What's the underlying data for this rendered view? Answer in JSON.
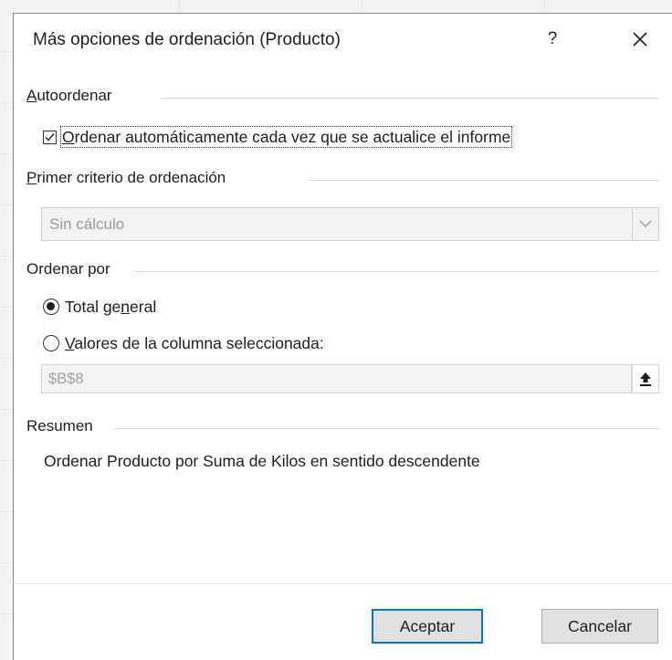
{
  "dialog": {
    "title": "Más opciones de ordenación (Producto)",
    "help_label": "?",
    "close_label": "×"
  },
  "autosort": {
    "section_title_first": "A",
    "section_title_rest": "utoordenar",
    "checkbox_checked": true,
    "checkbox_label_first": "O",
    "checkbox_label_rest": "rdenar automáticamente cada vez que se actualice el informe"
  },
  "first_key": {
    "section_title_first": "P",
    "section_title_rest": "rimer criterio de ordenación",
    "selected_value": "Sin cálculo"
  },
  "sort_by": {
    "section_title": "Ordenar por",
    "options": [
      {
        "pre": "Total ge",
        "accel": "n",
        "post": "eral",
        "selected": true
      },
      {
        "pre": "",
        "accel": "V",
        "post": "alores de la columna seleccionada:",
        "selected": false
      }
    ],
    "reference_value": "$B$8"
  },
  "summary": {
    "section_title": "Resumen",
    "text": "Ordenar Producto por Suma de Kilos en sentido descendente"
  },
  "buttons": {
    "ok_label": "Aceptar",
    "cancel_label": "Cancelar"
  },
  "colors": {
    "accent": "#0078d7",
    "disabled_text": "#9a9a9a"
  }
}
